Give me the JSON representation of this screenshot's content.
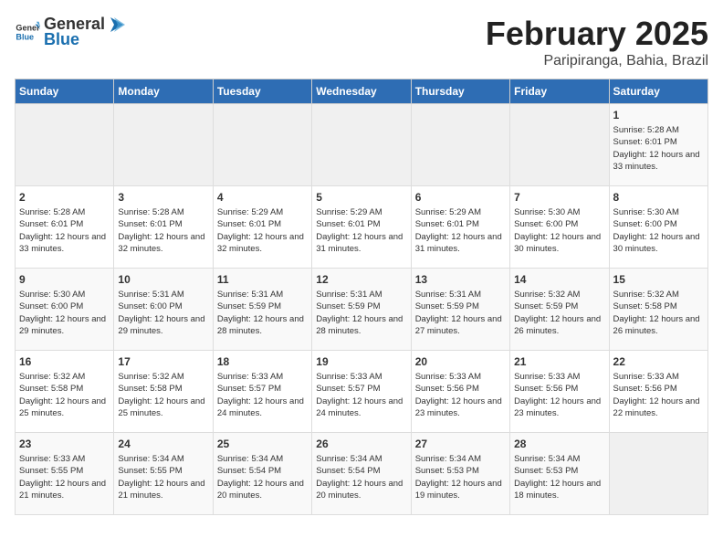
{
  "header": {
    "logo_general": "General",
    "logo_blue": "Blue",
    "title": "February 2025",
    "subtitle": "Paripiranga, Bahia, Brazil"
  },
  "calendar": {
    "days_of_week": [
      "Sunday",
      "Monday",
      "Tuesday",
      "Wednesday",
      "Thursday",
      "Friday",
      "Saturday"
    ],
    "weeks": [
      [
        {
          "day": "",
          "info": ""
        },
        {
          "day": "",
          "info": ""
        },
        {
          "day": "",
          "info": ""
        },
        {
          "day": "",
          "info": ""
        },
        {
          "day": "",
          "info": ""
        },
        {
          "day": "",
          "info": ""
        },
        {
          "day": "1",
          "info": "Sunrise: 5:28 AM\nSunset: 6:01 PM\nDaylight: 12 hours and 33 minutes."
        }
      ],
      [
        {
          "day": "2",
          "info": "Sunrise: 5:28 AM\nSunset: 6:01 PM\nDaylight: 12 hours and 33 minutes."
        },
        {
          "day": "3",
          "info": "Sunrise: 5:28 AM\nSunset: 6:01 PM\nDaylight: 12 hours and 32 minutes."
        },
        {
          "day": "4",
          "info": "Sunrise: 5:29 AM\nSunset: 6:01 PM\nDaylight: 12 hours and 32 minutes."
        },
        {
          "day": "5",
          "info": "Sunrise: 5:29 AM\nSunset: 6:01 PM\nDaylight: 12 hours and 31 minutes."
        },
        {
          "day": "6",
          "info": "Sunrise: 5:29 AM\nSunset: 6:01 PM\nDaylight: 12 hours and 31 minutes."
        },
        {
          "day": "7",
          "info": "Sunrise: 5:30 AM\nSunset: 6:00 PM\nDaylight: 12 hours and 30 minutes."
        },
        {
          "day": "8",
          "info": "Sunrise: 5:30 AM\nSunset: 6:00 PM\nDaylight: 12 hours and 30 minutes."
        }
      ],
      [
        {
          "day": "9",
          "info": "Sunrise: 5:30 AM\nSunset: 6:00 PM\nDaylight: 12 hours and 29 minutes."
        },
        {
          "day": "10",
          "info": "Sunrise: 5:31 AM\nSunset: 6:00 PM\nDaylight: 12 hours and 29 minutes."
        },
        {
          "day": "11",
          "info": "Sunrise: 5:31 AM\nSunset: 5:59 PM\nDaylight: 12 hours and 28 minutes."
        },
        {
          "day": "12",
          "info": "Sunrise: 5:31 AM\nSunset: 5:59 PM\nDaylight: 12 hours and 28 minutes."
        },
        {
          "day": "13",
          "info": "Sunrise: 5:31 AM\nSunset: 5:59 PM\nDaylight: 12 hours and 27 minutes."
        },
        {
          "day": "14",
          "info": "Sunrise: 5:32 AM\nSunset: 5:59 PM\nDaylight: 12 hours and 26 minutes."
        },
        {
          "day": "15",
          "info": "Sunrise: 5:32 AM\nSunset: 5:58 PM\nDaylight: 12 hours and 26 minutes."
        }
      ],
      [
        {
          "day": "16",
          "info": "Sunrise: 5:32 AM\nSunset: 5:58 PM\nDaylight: 12 hours and 25 minutes."
        },
        {
          "day": "17",
          "info": "Sunrise: 5:32 AM\nSunset: 5:58 PM\nDaylight: 12 hours and 25 minutes."
        },
        {
          "day": "18",
          "info": "Sunrise: 5:33 AM\nSunset: 5:57 PM\nDaylight: 12 hours and 24 minutes."
        },
        {
          "day": "19",
          "info": "Sunrise: 5:33 AM\nSunset: 5:57 PM\nDaylight: 12 hours and 24 minutes."
        },
        {
          "day": "20",
          "info": "Sunrise: 5:33 AM\nSunset: 5:56 PM\nDaylight: 12 hours and 23 minutes."
        },
        {
          "day": "21",
          "info": "Sunrise: 5:33 AM\nSunset: 5:56 PM\nDaylight: 12 hours and 23 minutes."
        },
        {
          "day": "22",
          "info": "Sunrise: 5:33 AM\nSunset: 5:56 PM\nDaylight: 12 hours and 22 minutes."
        }
      ],
      [
        {
          "day": "23",
          "info": "Sunrise: 5:33 AM\nSunset: 5:55 PM\nDaylight: 12 hours and 21 minutes."
        },
        {
          "day": "24",
          "info": "Sunrise: 5:34 AM\nSunset: 5:55 PM\nDaylight: 12 hours and 21 minutes."
        },
        {
          "day": "25",
          "info": "Sunrise: 5:34 AM\nSunset: 5:54 PM\nDaylight: 12 hours and 20 minutes."
        },
        {
          "day": "26",
          "info": "Sunrise: 5:34 AM\nSunset: 5:54 PM\nDaylight: 12 hours and 20 minutes."
        },
        {
          "day": "27",
          "info": "Sunrise: 5:34 AM\nSunset: 5:53 PM\nDaylight: 12 hours and 19 minutes."
        },
        {
          "day": "28",
          "info": "Sunrise: 5:34 AM\nSunset: 5:53 PM\nDaylight: 12 hours and 18 minutes."
        },
        {
          "day": "",
          "info": ""
        }
      ]
    ]
  }
}
